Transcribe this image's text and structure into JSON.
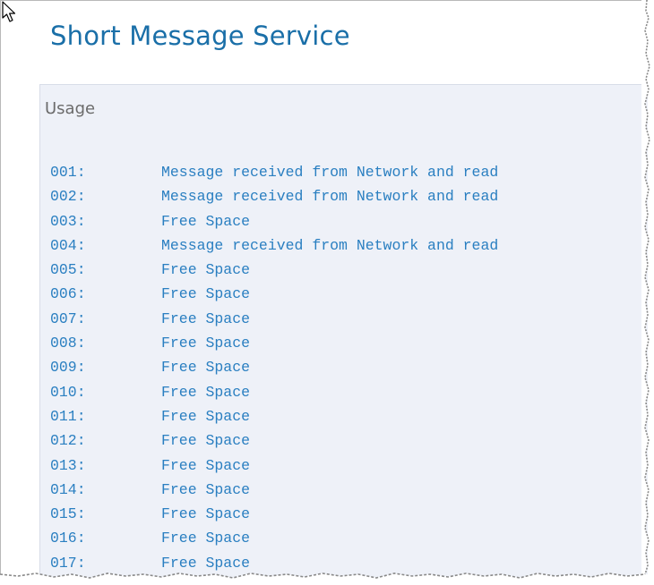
{
  "header": {
    "title": "Short Message Service"
  },
  "usage": {
    "heading": "Usage",
    "slots": [
      {
        "id": "001:",
        "status": "Message received from Network and read"
      },
      {
        "id": "002:",
        "status": "Message received from Network and read"
      },
      {
        "id": "003:",
        "status": "Free Space"
      },
      {
        "id": "004:",
        "status": "Message received from Network and read"
      },
      {
        "id": "005:",
        "status": "Free Space"
      },
      {
        "id": "006:",
        "status": "Free Space"
      },
      {
        "id": "007:",
        "status": "Free Space"
      },
      {
        "id": "008:",
        "status": "Free Space"
      },
      {
        "id": "009:",
        "status": "Free Space"
      },
      {
        "id": "010:",
        "status": "Free Space"
      },
      {
        "id": "011:",
        "status": "Free Space"
      },
      {
        "id": "012:",
        "status": "Free Space"
      },
      {
        "id": "013:",
        "status": "Free Space"
      },
      {
        "id": "014:",
        "status": "Free Space"
      },
      {
        "id": "015:",
        "status": "Free Space"
      },
      {
        "id": "016:",
        "status": "Free Space"
      },
      {
        "id": "017:",
        "status": "Free Space"
      }
    ]
  },
  "colors": {
    "title": "#1a6fa8",
    "slot_text": "#2a7fc1",
    "panel_background": "#eef1f8",
    "heading_text": "#6b6b6b"
  },
  "icons": {
    "cursor": "mouse-pointer-icon"
  }
}
